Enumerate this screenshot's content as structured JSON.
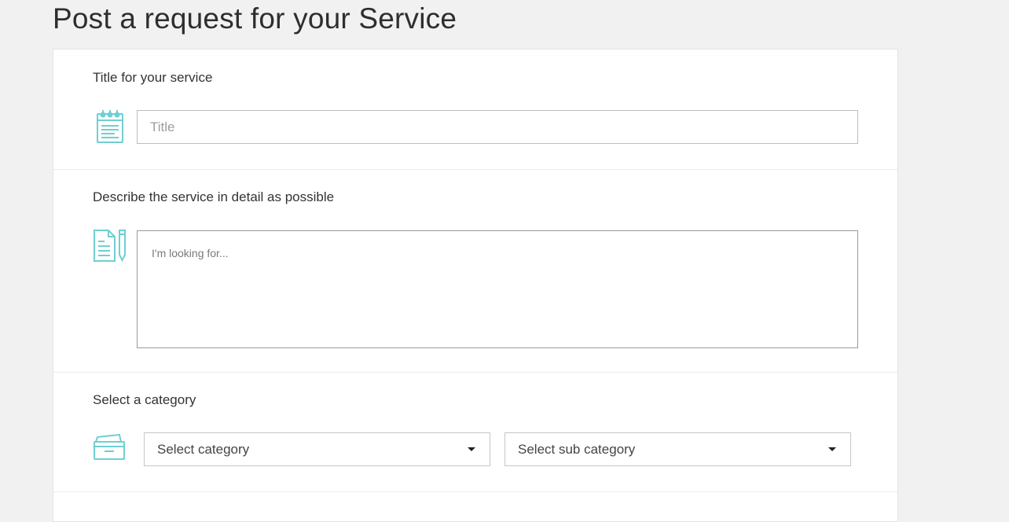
{
  "page": {
    "title": "Post a request for your Service"
  },
  "colors": {
    "accent_icon": "#6fcfd2",
    "background": "#f1f1f1",
    "card": "#ffffff"
  },
  "title_section": {
    "label": "Title for your service",
    "icon": "notepad-icon",
    "input_placeholder": "Title",
    "input_value": ""
  },
  "description_section": {
    "label": "Describe the service in detail as possible",
    "icon": "document-pencil-icon",
    "textarea_placeholder": "I'm looking for...",
    "textarea_value": ""
  },
  "category_section": {
    "label": "Select a category",
    "icon": "folder-icon",
    "category_select": {
      "selected": "Select category"
    },
    "subcategory_select": {
      "selected": "Select sub category"
    }
  }
}
